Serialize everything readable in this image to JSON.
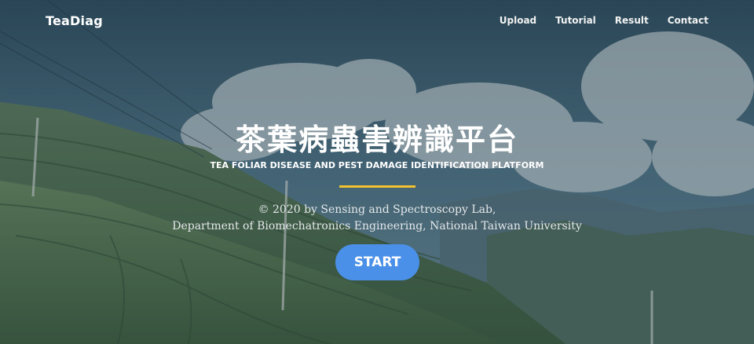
{
  "navbar": {
    "brand": "TeaDiag",
    "links": [
      {
        "label": "Upload"
      },
      {
        "label": "Tutorial"
      },
      {
        "label": "Result"
      },
      {
        "label": "Contact"
      }
    ]
  },
  "hero": {
    "title_zh": "茶葉病蟲害辨識平台",
    "title_en": "TEA FOLIAR DISEASE AND PEST DAMAGE IDENTIFICATION PLATFORM",
    "credit_line1": "© 2020 by Sensing and Spectroscopy Lab,",
    "credit_line2": "Department of Biomechatronics Engineering, National Taiwan University",
    "start_label": "START"
  },
  "colors": {
    "accent_divider": "#f2c230",
    "start_button": "#4a90e8"
  }
}
